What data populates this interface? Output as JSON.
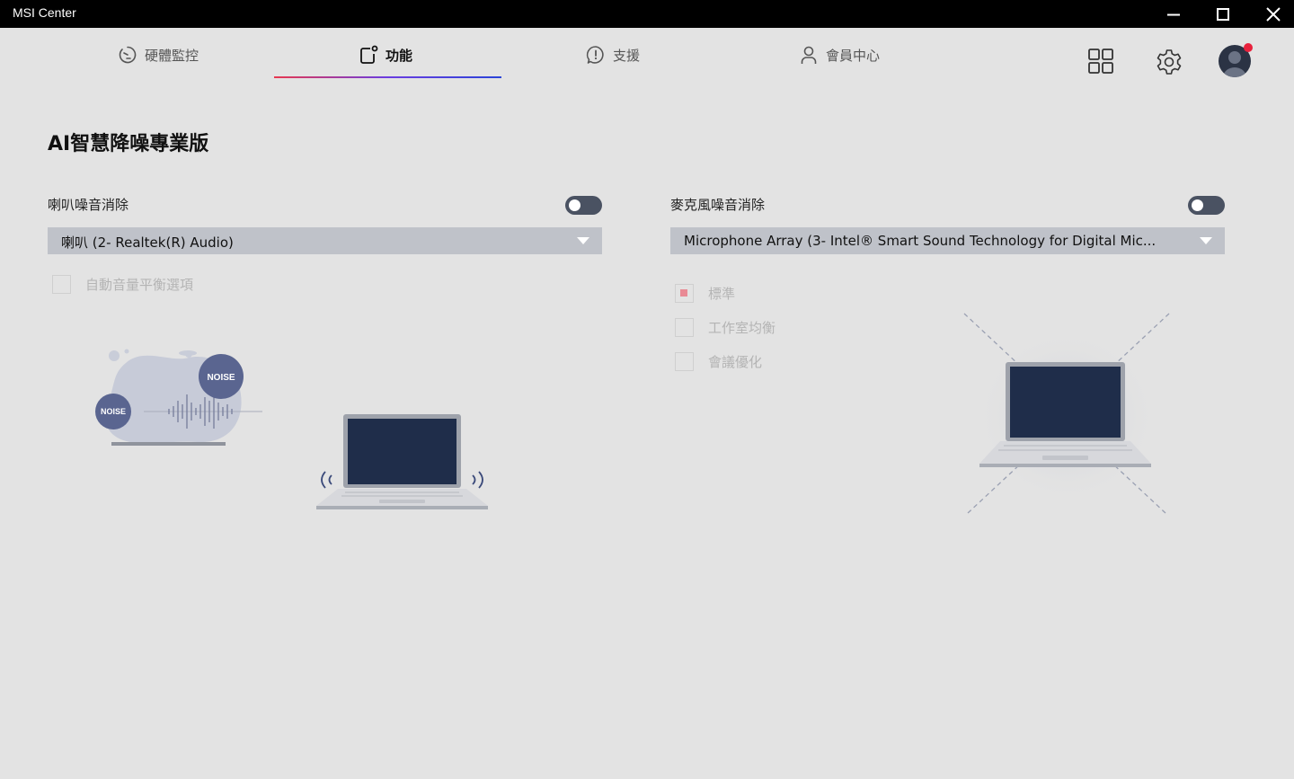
{
  "window": {
    "title": "MSI Center"
  },
  "tabs": [
    {
      "label": "硬體監控",
      "icon": "gauge-icon",
      "active": false
    },
    {
      "label": "功能",
      "icon": "features-icon",
      "active": true
    },
    {
      "label": "支援",
      "icon": "support-icon",
      "active": false
    },
    {
      "label": "會員中心",
      "icon": "user-icon",
      "active": false
    }
  ],
  "toolbar": {
    "icons": [
      "grid-icon",
      "gear-icon",
      "avatar"
    ],
    "notification": true
  },
  "page": {
    "title": "AI智慧降噪專業版"
  },
  "speaker": {
    "label": "喇叭噪音消除",
    "toggle_on": false,
    "device": "喇叭 (2- Realtek(R) Audio)",
    "options": [
      {
        "label": "自動音量平衡選項",
        "checked": false
      }
    ],
    "illustration": {
      "noise_badges": [
        "NOISE",
        "NOISE"
      ]
    }
  },
  "mic": {
    "label": "麥克風噪音消除",
    "toggle_on": false,
    "device": "Microphone Array (3- Intel® Smart Sound Technology for Digital Mic...",
    "options": [
      {
        "label": "標準",
        "checked": true
      },
      {
        "label": "工作室均衡",
        "checked": false
      },
      {
        "label": "會議優化",
        "checked": false
      }
    ]
  },
  "colors": {
    "accent_start": "#e8384f",
    "accent_end": "#2a44d8",
    "toggle": "#4a5262",
    "select_bg": "#bfc2c9",
    "laptop_screen": "#1f2d4a",
    "noise_badge": "#5a6590"
  }
}
